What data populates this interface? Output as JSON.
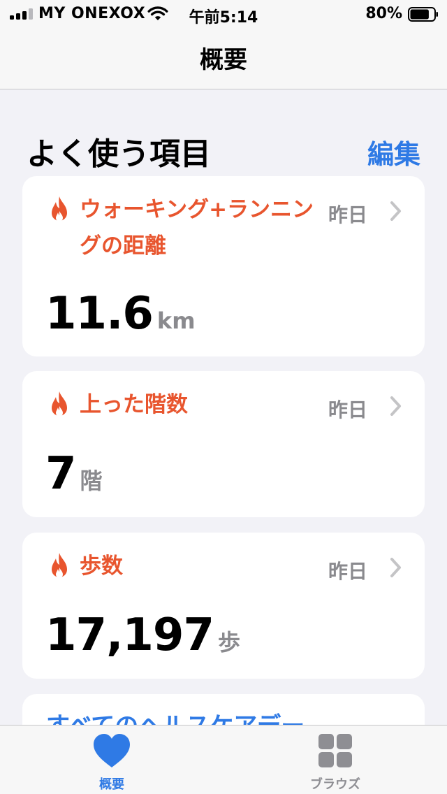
{
  "status_bar": {
    "carrier": "MY ONEXOX",
    "time": "午前5:14",
    "battery_percent": "80%",
    "battery_level": 0.8,
    "signal_bars": 3
  },
  "nav": {
    "title": "概要"
  },
  "favorites": {
    "title": "よく使う項目",
    "edit_label": "編集",
    "cards": [
      {
        "title": "ウォーキング+ランニングの距離",
        "date": "昨日",
        "value": "11.6",
        "unit": "km",
        "icon": "flame-icon"
      },
      {
        "title": "上った階数",
        "date": "昨日",
        "value": "7",
        "unit": "階",
        "icon": "flame-icon"
      },
      {
        "title": "歩数",
        "date": "昨日",
        "value": "17,197",
        "unit": "歩",
        "icon": "flame-icon"
      }
    ],
    "show_all_label": "すべてのヘルスケアデー"
  },
  "tab_bar": {
    "tabs": [
      {
        "label": "概要",
        "icon": "heart-icon",
        "active": true
      },
      {
        "label": "ブラウズ",
        "icon": "grid-icon",
        "active": false
      }
    ]
  },
  "colors": {
    "accent": "#2f7ae5",
    "activity": "#e8552e",
    "secondary_text": "#8a8a8e",
    "background": "#f2f2f7",
    "inactive_tab": "#8e8e93"
  }
}
